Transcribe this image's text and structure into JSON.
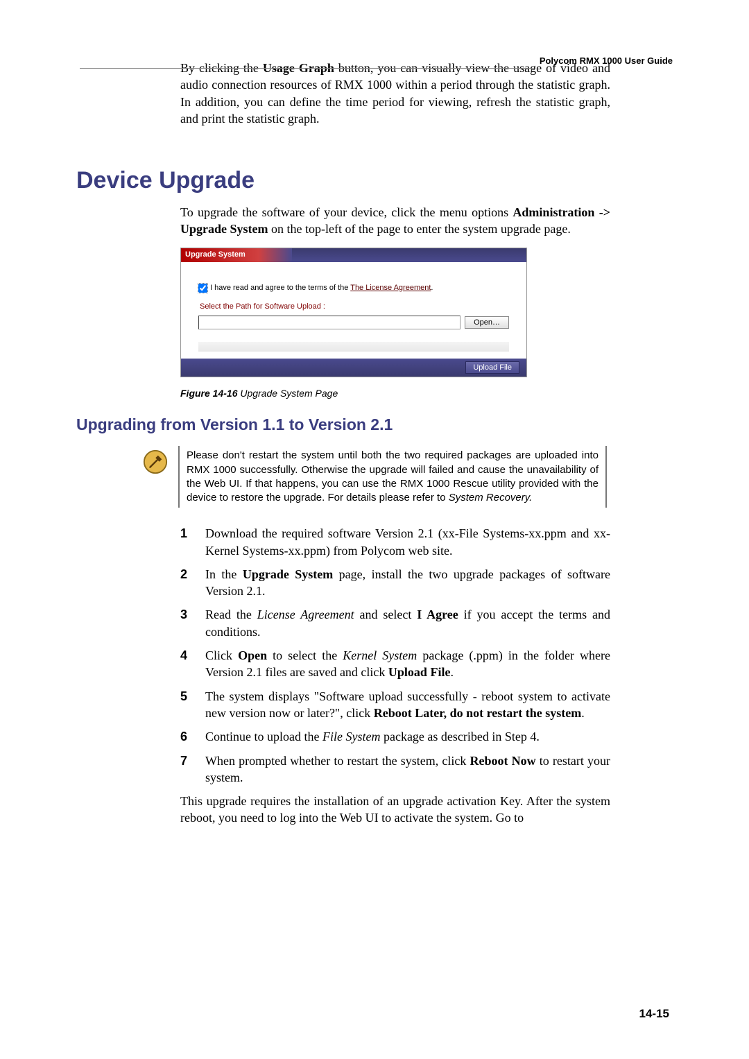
{
  "header": {
    "doc_title": "Polycom RMX 1000 User Guide"
  },
  "intro": "By clicking the Usage Graph button, you can visually view the usage of video and audio connection resources of RMX 1000 within a period through the statistic graph. In addition, you can define the time period for viewing, refresh the statistic graph, and print the statistic graph.",
  "intro_bold": "Usage Graph",
  "h1": "Device Upgrade",
  "para2_pre": "To upgrade the software of your device, click the menu options ",
  "para2_bold": "Administration -> Upgrade System",
  "para2_post": " on the top-left of the page to enter the system upgrade page.",
  "figure": {
    "tab": "Upgrade System",
    "agree_pre": "I have read and agree to the terms of the ",
    "agree_link": "The License Agreement",
    "path_label": "Select the Path for Software Upload :",
    "open": "Open…",
    "upload": "Upload File",
    "caption_num": "Figure 14-16",
    "caption_text": " Upgrade System Page"
  },
  "h2": "Upgrading from Version 1.1 to Version 2.1",
  "note": "Please don't restart the system until both the two required packages are uploaded into RMX 1000 successfully. Otherwise the upgrade will failed and cause the unavailability of the Web UI. If that happens, you can use the RMX 1000 Rescue utility provided with the device to restore the upgrade. For details please refer to ",
  "note_ital": "System Recovery.",
  "steps": {
    "s1": "Download the required software Version 2.1 (xx-File Systems-xx.ppm and xx-Kernel Systems-xx.ppm) from Polycom web site.",
    "s2_pre": "In the ",
    "s2_b": "Upgrade System",
    "s2_post": " page, install the two upgrade packages of software Version 2.1.",
    "s3_pre": "Read the ",
    "s3_i": "License Agreement",
    "s3_mid": " and select ",
    "s3_b": "I Agree",
    "s3_post": " if you accept the terms and conditions.",
    "s4_pre": "Click ",
    "s4_b1": "Open",
    "s4_mid1": " to select the ",
    "s4_i": "Kernel System",
    "s4_mid2": " package (.ppm) in the folder where Version 2.1 files are saved and click ",
    "s4_b2": "Upload File",
    "s4_post": ".",
    "s5_pre": "The system displays \"Software upload successfully - reboot system to activate new version now or later?\", click ",
    "s5_b": "Reboot Later, do not restart the system",
    "s5_post": ".",
    "s6_pre": "Continue to upload the ",
    "s6_i": "File System",
    "s6_post": " package as described in Step 4.",
    "s7_pre": "When prompted whether to restart the system, click ",
    "s7_b": "Reboot Now",
    "s7_post": " to restart your system."
  },
  "closing": "This upgrade requires the installation of an upgrade activation Key. After the system reboot, you need to log into the Web UI to activate the system. Go to",
  "pagenum": "14-15"
}
